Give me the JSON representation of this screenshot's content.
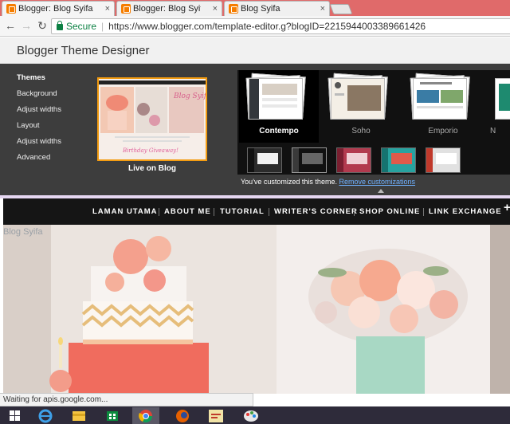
{
  "browser": {
    "tabs": [
      {
        "title": "Blogger: Blog Syifa - Tem",
        "active": true
      },
      {
        "title": "Blogger: Blog Syifa - Edit",
        "active": false
      },
      {
        "title": "Blog Syifa",
        "active": false
      }
    ],
    "tab_close_glyph": "×",
    "nav": {
      "back": "←",
      "forward": "→",
      "reload": "↻"
    },
    "secure_label": "Secure",
    "url": "https://www.blogger.com/template-editor.g?blogID=2215944003389661426"
  },
  "designer": {
    "title": "Blogger Theme Designer",
    "menu": [
      "Themes",
      "Background",
      "Adjust widths",
      "Layout",
      "Adjust widths",
      "Advanced"
    ],
    "selected_menu": "Themes",
    "live_label": "Live on Blog",
    "preview": {
      "blog_title": "Blog Syifa",
      "banner_text": "Birthday Giveaway!"
    },
    "templates": [
      "Contempo",
      "Soho",
      "Emporio",
      "N"
    ],
    "selected_template": "Contempo",
    "customized_text": "You've customized this theme.",
    "remove_link": "Remove customizations"
  },
  "blog": {
    "nav": [
      "LAMAN UTAMA",
      "ABOUT ME",
      "TUTORIAL",
      "WRITER'S CORNER",
      "SHOP ONLINE",
      "LINK EXCHANGE"
    ],
    "plus": "+",
    "name": "Blog Syifa"
  },
  "status_text": "Waiting for apis.google.com...",
  "taskbar": {
    "apps": [
      "start-icon",
      "ie-icon",
      "file-explorer-icon",
      "store-icon",
      "chrome-icon",
      "firefox-icon",
      "document-icon",
      "paint-icon"
    ],
    "active": "chrome-icon"
  },
  "colors": {
    "tabstrip": "#e06a6a",
    "designer_bg": "#3d3d3d",
    "selected_border": "#f39c12",
    "link": "#6fb1ff",
    "blog_nav": "#151515"
  }
}
